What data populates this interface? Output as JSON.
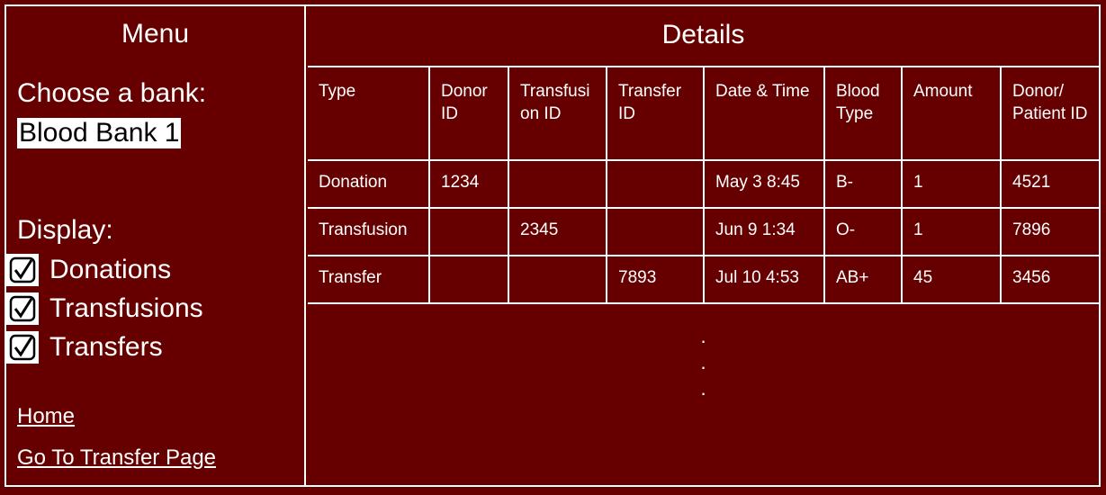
{
  "sidebar": {
    "title": "Menu",
    "bank_label": "Choose a bank:",
    "bank_selected": "Blood Bank 1",
    "display_label": "Display:",
    "filters": [
      {
        "label": "Donations",
        "checked": true
      },
      {
        "label": "Transfusions",
        "checked": true
      },
      {
        "label": "Transfers",
        "checked": true
      }
    ],
    "links": {
      "home": "Home",
      "transfer_page": "Go To Transfer Page"
    }
  },
  "details": {
    "title": "Details",
    "columns": [
      "Type",
      "Donor ID",
      "Transfusion ID",
      "Transfer ID",
      "Date & Time",
      "Blood Type",
      "Amount",
      "Donor/ Patient ID"
    ],
    "rows": [
      [
        "Donation",
        "1234",
        "",
        "",
        "May 3 8:45",
        "B-",
        "1",
        "4521"
      ],
      [
        "Transfusion",
        "",
        "2345",
        "",
        "Jun 9 1:34",
        "O-",
        "1",
        "7896"
      ],
      [
        "Transfer",
        "",
        "",
        "7893",
        "Jul 10 4:53",
        "AB+",
        "45",
        "3456"
      ]
    ],
    "continuation": [
      ".",
      ".",
      "."
    ]
  },
  "colors": {
    "background": "#660000",
    "foreground": "#ffffff"
  },
  "icons": {
    "checkbox": "check-icon"
  }
}
